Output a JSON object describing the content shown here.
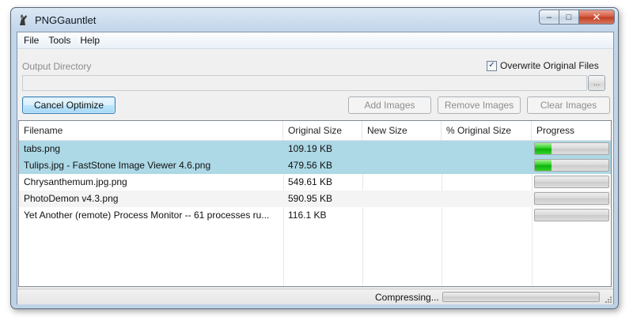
{
  "window": {
    "title": "PNGGauntlet",
    "minimize_glyph": "–",
    "maximize_glyph": "□",
    "close_glyph": "✕"
  },
  "menu": [
    "File",
    "Tools",
    "Help"
  ],
  "output": {
    "label": "Output Directory",
    "value": "",
    "browse_label": "..."
  },
  "overwrite": {
    "label": "Overwrite Original Files",
    "checked": true,
    "check_glyph": "✓"
  },
  "buttons": {
    "cancel_optimize": "Cancel Optimize",
    "add_images": "Add Images",
    "remove_images": "Remove Images",
    "clear_images": "Clear Images"
  },
  "table": {
    "columns": [
      "Filename",
      "Original Size",
      "New Size",
      "% Original Size",
      "Progress"
    ],
    "rows": [
      {
        "filename": "tabs.png",
        "original_size": "109.19 KB",
        "new_size": "",
        "percent_original": "",
        "progress": 0.23,
        "selected": true
      },
      {
        "filename": "Tulips.jpg  -  FastStone Image Viewer 4.6.png",
        "original_size": "479.56 KB",
        "new_size": "",
        "percent_original": "",
        "progress": 0.23,
        "selected": true
      },
      {
        "filename": "Chrysanthemum.jpg.png",
        "original_size": "549.61 KB",
        "new_size": "",
        "percent_original": "",
        "progress": 0,
        "selected": false
      },
      {
        "filename": "PhotoDemon v4.3.png",
        "original_size": "590.95 KB",
        "new_size": "",
        "percent_original": "",
        "progress": 0,
        "selected": false
      },
      {
        "filename": "Yet Another (remote) Process Monitor -- 61 processes ru...",
        "original_size": "116.1 KB",
        "new_size": "",
        "percent_original": "",
        "progress": 0,
        "selected": false
      }
    ]
  },
  "status": {
    "text": "Compressing...",
    "progress": 0
  },
  "colors": {
    "selection": "#add8e6",
    "progress_green": "#0eb20a",
    "title_bar": "#c3d6ea"
  }
}
